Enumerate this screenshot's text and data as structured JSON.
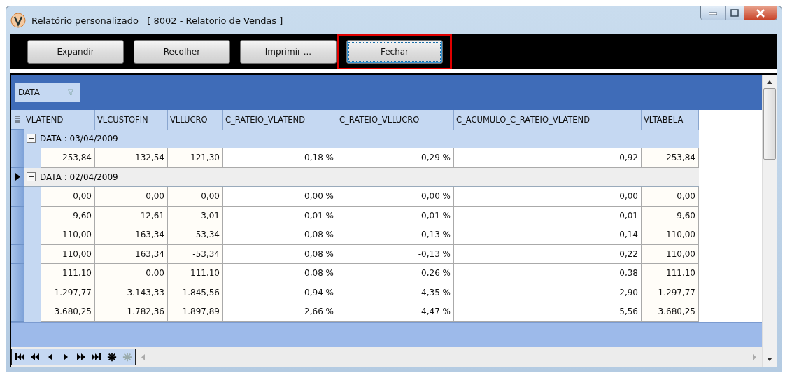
{
  "window": {
    "title": "Relatório personalizado   [ 8002 - Relatorio de Vendas ]"
  },
  "toolbar": {
    "buttons": [
      {
        "label": "Expandir",
        "focused": false
      },
      {
        "label": "Recolher",
        "focused": false
      },
      {
        "label": "Imprimir ...",
        "focused": false
      },
      {
        "label": "Fechar",
        "focused": true,
        "highlighted": true
      }
    ]
  },
  "group_panel": {
    "chips": [
      "DATA"
    ]
  },
  "table": {
    "columns": [
      "VLATEND",
      "VLCUSTOFIN",
      "VLLUCRO",
      "C_RATEIO_VLATEND",
      "C_RATEIO_VLLUCRO",
      "C_ACUMULO_C_RATEIO_VLATEND",
      "VLTABELA"
    ],
    "groups": [
      {
        "label": "DATA : 03/04/2009",
        "expanded": true,
        "current": false,
        "rows": [
          [
            "253,84",
            "132,54",
            "121,30",
            "0,18 %",
            "0,29 %",
            "0,92",
            "253,84"
          ]
        ]
      },
      {
        "label": "DATA : 02/04/2009",
        "expanded": true,
        "current": true,
        "rows": [
          [
            "0,00",
            "0,00",
            "0,00",
            "0,00 %",
            "0,00 %",
            "0,00",
            "0,00"
          ],
          [
            "9,60",
            "12,61",
            "-3,01",
            "0,01 %",
            "-0,01 %",
            "0,01",
            "9,60"
          ],
          [
            "110,00",
            "163,34",
            "-53,34",
            "0,08 %",
            "-0,13 %",
            "0,14",
            "110,00"
          ],
          [
            "110,00",
            "163,34",
            "-53,34",
            "0,08 %",
            "-0,13 %",
            "0,22",
            "110,00"
          ],
          [
            "111,10",
            "0,00",
            "111,10",
            "0,08 %",
            "0,26 %",
            "0,38",
            "111,10"
          ],
          [
            "1.297,77",
            "3.143,33",
            "-1.845,56",
            "0,94 %",
            "-4,35 %",
            "2,90",
            "1.297,77"
          ],
          [
            "3.680,25",
            "1.782,36",
            "1.897,89",
            "2,66 %",
            "4,47 %",
            "5,56",
            "3.680,25"
          ]
        ]
      }
    ]
  },
  "navigator": {
    "buttons": [
      {
        "kind": "first",
        "disabled": false
      },
      {
        "kind": "prev-page",
        "disabled": false
      },
      {
        "kind": "prev",
        "disabled": false
      },
      {
        "kind": "next",
        "disabled": false
      },
      {
        "kind": "next-page",
        "disabled": false
      },
      {
        "kind": "last",
        "disabled": false
      },
      {
        "kind": "insert",
        "disabled": false
      },
      {
        "kind": "insert",
        "disabled": true
      }
    ]
  }
}
